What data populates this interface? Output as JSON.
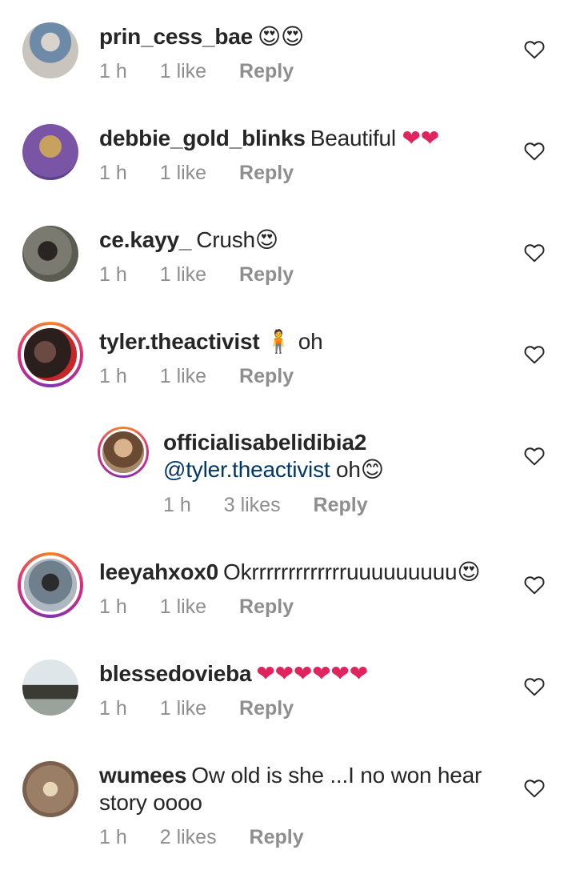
{
  "comments": [
    {
      "username": "prin_cess_bae",
      "text": "",
      "emoji": "😍😍",
      "time": "1 h",
      "likes": "1 like",
      "reply": "Reply",
      "avatar_color": "#b9b3a7",
      "story_ring": false
    },
    {
      "username": "debbie_gold_blinks",
      "text": "Beautiful",
      "emoji": "❤❤",
      "time": "1 h",
      "likes": "1 like",
      "reply": "Reply",
      "avatar_color": "#7a55a6",
      "story_ring": false
    },
    {
      "username": "ce.kayy_",
      "text": "Crush",
      "emoji": "😍",
      "time": "1 h",
      "likes": "1 like",
      "reply": "Reply",
      "avatar_color": "#6b6a60",
      "story_ring": false
    },
    {
      "username": "tyler.theactivist",
      "text": "oh",
      "emoji": "🧍",
      "time": "1 h",
      "likes": "1 like",
      "reply": "Reply",
      "avatar_color": "#3b2b28",
      "story_ring": true
    },
    {
      "username": "officialisabelidibia2",
      "mention": "@tyler.theactivist",
      "text": "oh",
      "emoji": "😊",
      "time": "1 h",
      "likes": "3 likes",
      "reply": "Reply",
      "avatar_color": "#8a6a4f",
      "story_ring": true
    },
    {
      "username": "leeyahxox0",
      "text": "Okrrrrrrrrrrrrruuuuuuuuu",
      "emoji": "😍",
      "time": "1 h",
      "likes": "1 like",
      "reply": "Reply",
      "avatar_color": "#4e5a66",
      "story_ring": true
    },
    {
      "username": "blessedovieba",
      "text": "",
      "emoji": "❤❤❤❤❤❤",
      "time": "1 h",
      "likes": "1 like",
      "reply": "Reply",
      "avatar_color": "#9aa39b",
      "story_ring": false
    },
    {
      "username": "wumees",
      "text": "Ow old is she ...I no won hear",
      "text2": "story oooo",
      "emoji": "",
      "time": "1 h",
      "likes": "2 likes",
      "reply": "Reply",
      "avatar_color": "#8a6f5c",
      "story_ring": false
    }
  ],
  "colors": {
    "username": "#262626",
    "mention": "#00376b",
    "meta": "#8e8e8e",
    "heart_emoji": "#e0245e"
  },
  "icons": {
    "like": "heart-outline-icon"
  }
}
